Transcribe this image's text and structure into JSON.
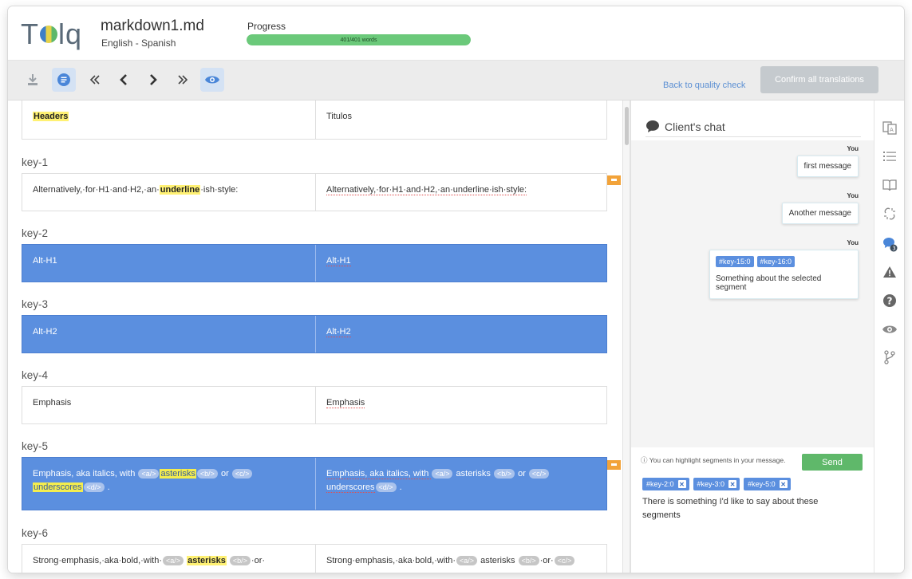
{
  "app": {
    "logo": "Tolq"
  },
  "file": {
    "name": "markdown1.md",
    "languages": "English - Spanish"
  },
  "progress": {
    "label": "Progress",
    "text": "401/401 words",
    "fraction": 1.0
  },
  "toolbar": {
    "icons": [
      "download-icon",
      "list-icon",
      "first-icon",
      "prev-icon",
      "next-icon",
      "last-icon",
      "eye-icon"
    ],
    "back_link": "Back to quality check",
    "confirm_label": "Confirm all translations"
  },
  "segments": [
    {
      "key": "",
      "source": "Headers",
      "target": "Titulos"
    },
    {
      "key": "key-1",
      "source_a": "Alternatively,·for·H1·and·H2,·an·",
      "source_hl": "underline",
      "source_b": "·ish·style:",
      "target": "Alternatively,·for·H1·and·H2,·an·underline·ish·style:"
    },
    {
      "key": "key-2",
      "source": "Alt-H1",
      "target": "Alt-H1"
    },
    {
      "key": "key-3",
      "source": "Alt-H2",
      "target": "Alt-H2"
    },
    {
      "key": "key-4",
      "source": "Emphasis",
      "target": "Emphasis"
    },
    {
      "key": "key-5",
      "source_a": "Emphasis, aka italics, with ",
      "tag_a": "<a/>",
      "source_hl": "asterisks",
      "tag_b": "<b/>",
      "source_or": " or ",
      "tag_c": "<c/>",
      "source_hl2": "underscores",
      "tag_d": "<d/>",
      "source_end": " .",
      "target_a": "Emphasis, aka italics, with ",
      "target_mid": " asterisks ",
      "target_or": " or ",
      "target_und": "underscores",
      "target_end": " ."
    },
    {
      "key": "key-6",
      "source_a": "Strong·emphasis,·aka·bold,·with·",
      "tag_a": "<a/>",
      "source_hl": "asterisks",
      "tag_b": "<b/>",
      "source_or": "·or·",
      "target_a": "Strong·emphasis,·aka·bold,·with·",
      "target_mid": " asterisks ",
      "tag_c": "<c/>",
      "target_or": "·or·"
    }
  ],
  "chat": {
    "title": "Client's chat",
    "you": "You",
    "messages": [
      {
        "text": "first message"
      },
      {
        "text": "Another message"
      },
      {
        "tags": [
          "#key-15:0",
          "#key-16:0"
        ],
        "text": "Something about the selected segment"
      }
    ],
    "hint": "You can highlight segments in your message.",
    "send_label": "Send",
    "chips": [
      "#key-2:0",
      "#key-3:0",
      "#key-5:0"
    ],
    "draft": "There is something I'd like to say  about these segments"
  },
  "rail": {
    "icons": [
      "translate-icon",
      "list-icon",
      "book-icon",
      "unlink-icon",
      "chat-icon",
      "warning-icon",
      "help-icon",
      "eye-icon",
      "branch-icon"
    ],
    "chat_badge": "3"
  },
  "colors": {
    "accent": "#5b8fdf",
    "progress": "#6bc97a",
    "send": "#5fb86a",
    "flag": "#f2a33a",
    "highlight": "#fff173"
  }
}
